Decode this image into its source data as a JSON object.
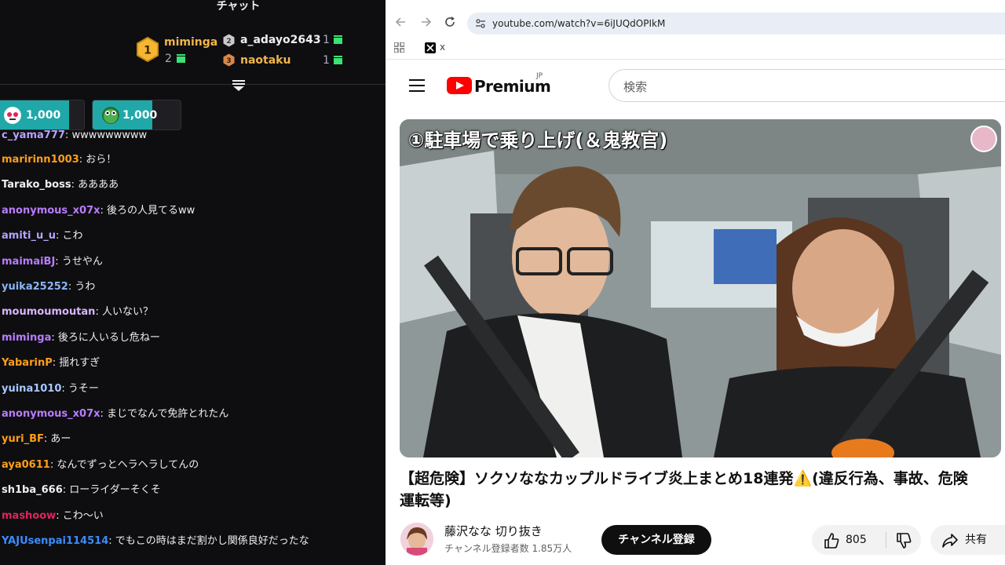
{
  "chat": {
    "title": "チャット",
    "leaderboard": {
      "first": {
        "rank": "1",
        "name": "miminga",
        "count": "2"
      },
      "second": {
        "rank": "2",
        "name": "a_adayo2643",
        "count": "1"
      },
      "third": {
        "rank": "3",
        "name": "naotaku",
        "count": "1"
      }
    },
    "hype": [
      {
        "amount": "1,000",
        "progress": 0.83
      },
      {
        "amount": "1,000",
        "progress": 0.68
      }
    ],
    "partial_line": {
      "user": "c_yama777",
      "message": "wwwwwwwww"
    },
    "messages": [
      {
        "user": "maririnn1003",
        "message": "おら！",
        "color": "#ff9f1a"
      },
      {
        "user": "Tarako_boss",
        "message": "ああああ",
        "color": "#efeff1"
      },
      {
        "user": "anonymous_x07x",
        "message": "後ろの人見てるww",
        "color": "#b97cff"
      },
      {
        "user": "amiti_u_u",
        "message": "こわ",
        "color": "#b6a3ff"
      },
      {
        "user": "maimaiBJ",
        "message": "うせやん",
        "color": "#b97cff"
      },
      {
        "user": "yuika25252",
        "message": "うわ",
        "color": "#8ab4f8"
      },
      {
        "user": "moumoumoutan",
        "message": "人いない？",
        "color": "#d6b6ff"
      },
      {
        "user": "miminga",
        "message": "後ろに人いるし危ねー",
        "color": "#b97cff"
      },
      {
        "user": "YabarinP",
        "message": "揺れすぎ",
        "color": "#ff9f1a"
      },
      {
        "user": "yuina1010",
        "message": "うそー",
        "color": "#a8c8ff"
      },
      {
        "user": "anonymous_x07x",
        "message": "まじでなんで免許とれたん",
        "color": "#b97cff"
      },
      {
        "user": "yuri_BF",
        "message": "あー",
        "color": "#ff9f1a"
      },
      {
        "user": "aya0611",
        "message": "なんでずっとヘラヘラしてんの",
        "color": "#ff9f1a"
      },
      {
        "user": "sh1ba_666",
        "message": "ローライダーそくそ",
        "color": "#efeff1"
      },
      {
        "user": "mashoow",
        "message": "こわ〜い",
        "color": "#e0245e"
      },
      {
        "user": "YAJUsenpai114514",
        "message": "でもこの時はまだ割かし関係良好だったな",
        "color": "#3b8cff"
      }
    ]
  },
  "browser": {
    "url": "youtube.com/watch?v=6iJUQdOPIkM",
    "bookmark_x_label": "x",
    "yt": {
      "logo_text": "Premium",
      "region": "JP",
      "search_placeholder": "検索"
    },
    "video": {
      "overlay_title": "①駐車場で乗り上げ(＆鬼教官)",
      "title": "【超危険】ソクソななカップルドライブ炎上まとめ18連発⚠️(違反行為、事故、危険運転等)",
      "channel_name": "藤沢なな 切り抜き",
      "subscribers": "チャンネル登録者数 1.85万人",
      "subscribe_label": "チャンネル登録",
      "likes": "805",
      "share_label": "共有"
    }
  },
  "colors": {
    "chat_bg": "#0e0e10",
    "gold": "#f1b54a",
    "hype_fill": "#20a8a8",
    "gift_green": "#3ae374",
    "yt_red": "#ff0000"
  }
}
